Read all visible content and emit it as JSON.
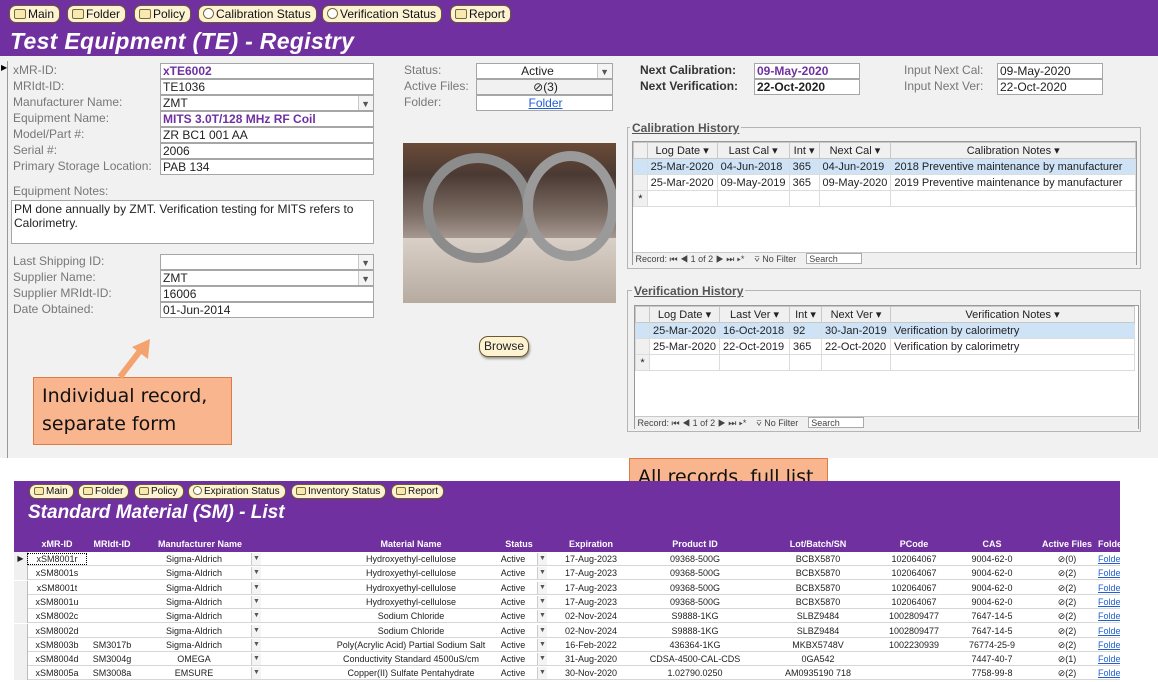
{
  "te_form": {
    "nav": [
      "Main",
      "Folder",
      "Policy",
      "Calibration Status",
      "Verification Status",
      "Report"
    ],
    "title": "Test Equipment (TE) - Registry",
    "fields": {
      "xmr_id_label": "xMR-ID:",
      "xmr_id": "xTE6002",
      "mrldt_id_label": "MRIdt-ID:",
      "mrldt_id": "TE1036",
      "manufacturer_label": "Manufacturer Name:",
      "manufacturer": "ZMT",
      "equipment_label": "Equipment Name:",
      "equipment": "MITS 3.0T/128 MHz RF Coil",
      "model_label": "Model/Part #:",
      "model": "ZR BC1 001 AA",
      "serial_label": "Serial #:",
      "serial": "2006",
      "storage_label": "Primary Storage Location:",
      "storage": "PAB 134",
      "notes_label": "Equipment Notes:",
      "notes": "PM done annually by ZMT.  Verification testing for MITS refers to Calorimetry.",
      "shipping_label": "Last Shipping ID:",
      "shipping": "",
      "supplier_label": "Supplier Name:",
      "supplier": "ZMT",
      "supplier_id_label": "Supplier MRIdt-ID:",
      "supplier_id": "16006",
      "date_label": "Date Obtained:",
      "date": "01-Jun-2014",
      "status_label": "Status:",
      "status": "Active",
      "files_label": "Active Files:",
      "files": "(3)",
      "folder_label": "Folder:",
      "folder": "Folder",
      "next_cal_label": "Next Calibration:",
      "next_cal": "09-May-2020",
      "next_ver_label": "Next Verification:",
      "next_ver": "22-Oct-2020",
      "input_cal_label": "Input Next Cal:",
      "input_cal": "09-May-2020",
      "input_ver_label": "Input Next Ver:",
      "input_ver": "22-Oct-2020",
      "browse": "Browse"
    },
    "cal_history": {
      "title": "Calibration History",
      "headers": [
        "Log Date",
        "Last Cal",
        "Int",
        "Next Cal",
        "Calibration Notes"
      ],
      "rows": [
        [
          "25-Mar-2020",
          "04-Jun-2018",
          "365",
          "04-Jun-2019",
          "2018 Preventive maintenance by manufacturer"
        ],
        [
          "25-Mar-2020",
          "09-May-2019",
          "365",
          "09-May-2020",
          "2019 Preventive maintenance by manufacturer"
        ]
      ],
      "record": "Record:",
      "rec_pos": "1 of 2",
      "nofilter": "No Filter",
      "search": "Search"
    },
    "ver_history": {
      "title": "Verification History",
      "headers": [
        "Log Date",
        "Last Ver",
        "Int",
        "Next Ver",
        "Verification Notes"
      ],
      "rows": [
        [
          "25-Mar-2020",
          "16-Oct-2018",
          "92",
          "30-Jan-2019",
          "Verification by calorimetry"
        ],
        [
          "25-Mar-2020",
          "22-Oct-2019",
          "365",
          "22-Oct-2020",
          "Verification by calorimetry"
        ]
      ],
      "record": "Record:",
      "rec_pos": "1 of 2",
      "nofilter": "No Filter",
      "search": "Search"
    }
  },
  "callouts": {
    "individual": "Individual record, separate form",
    "all": "All records, full list"
  },
  "sm_list": {
    "nav": [
      "Main",
      "Folder",
      "Policy",
      "Expiration Status",
      "Inventory Status",
      "Report"
    ],
    "title": "Standard Material (SM) - List",
    "headers": [
      "xMR-ID",
      "MRIdt-ID",
      "Manufacturer Name",
      "Material Name",
      "Status",
      "Expiration",
      "Product ID",
      "Lot/Batch/SN",
      "PCode",
      "CAS",
      "Active Files",
      "Folder"
    ],
    "rows": [
      [
        "xSM8001r",
        "",
        "Sigma-Aldrich",
        "Hydroxyethyl-cellulose",
        "Active",
        "17-Aug-2023",
        "09368-500G",
        "BCBX5870",
        "102064067",
        "9004-62-0",
        "(0)",
        "Folder"
      ],
      [
        "xSM8001s",
        "",
        "Sigma-Aldrich",
        "Hydroxyethyl-cellulose",
        "Active",
        "17-Aug-2023",
        "09368-500G",
        "BCBX5870",
        "102064067",
        "9004-62-0",
        "(2)",
        "Folder"
      ],
      [
        "xSM8001t",
        "",
        "Sigma-Aldrich",
        "Hydroxyethyl-cellulose",
        "Active",
        "17-Aug-2023",
        "09368-500G",
        "BCBX5870",
        "102064067",
        "9004-62-0",
        "(2)",
        "Folder"
      ],
      [
        "xSM8001u",
        "",
        "Sigma-Aldrich",
        "Hydroxyethyl-cellulose",
        "Active",
        "17-Aug-2023",
        "09368-500G",
        "BCBX5870",
        "102064067",
        "9004-62-0",
        "(2)",
        "Folder"
      ],
      [
        "xSM8002c",
        "",
        "Sigma-Aldrich",
        "Sodium Chloride",
        "Active",
        "02-Nov-2024",
        "S9888-1KG",
        "SLBZ9484",
        "1002809477",
        "7647-14-5",
        "(2)",
        "Folder"
      ],
      [
        "xSM8002d",
        "",
        "Sigma-Aldrich",
        "Sodium Chloride",
        "Active",
        "02-Nov-2024",
        "S9888-1KG",
        "SLBZ9484",
        "1002809477",
        "7647-14-5",
        "(2)",
        "Folder"
      ],
      [
        "xSM8003b",
        "SM3017b",
        "Sigma-Aldrich",
        "Poly(Acrylic Acid) Partial Sodium Salt",
        "Active",
        "16-Feb-2022",
        "436364-1KG",
        "MKBX5748V",
        "1002230939",
        "76774-25-9",
        "(2)",
        "Folder"
      ],
      [
        "xSM8004d",
        "SM3004g",
        "OMEGA",
        "Conductivity Standard 4500uS/cm",
        "Active",
        "31-Aug-2020",
        "CDSA-4500-CAL-CDS",
        "0GA542",
        "",
        "7447-40-7",
        "(1)",
        "Folder"
      ],
      [
        "xSM8005a",
        "SM3008a",
        "EMSURE",
        "Copper(II) Sulfate Pentahydrate",
        "Active",
        "30-Nov-2020",
        "1.02790.0250",
        "AM0935190 718",
        "",
        "7758-99-8",
        "(2)",
        "Folder"
      ]
    ]
  }
}
